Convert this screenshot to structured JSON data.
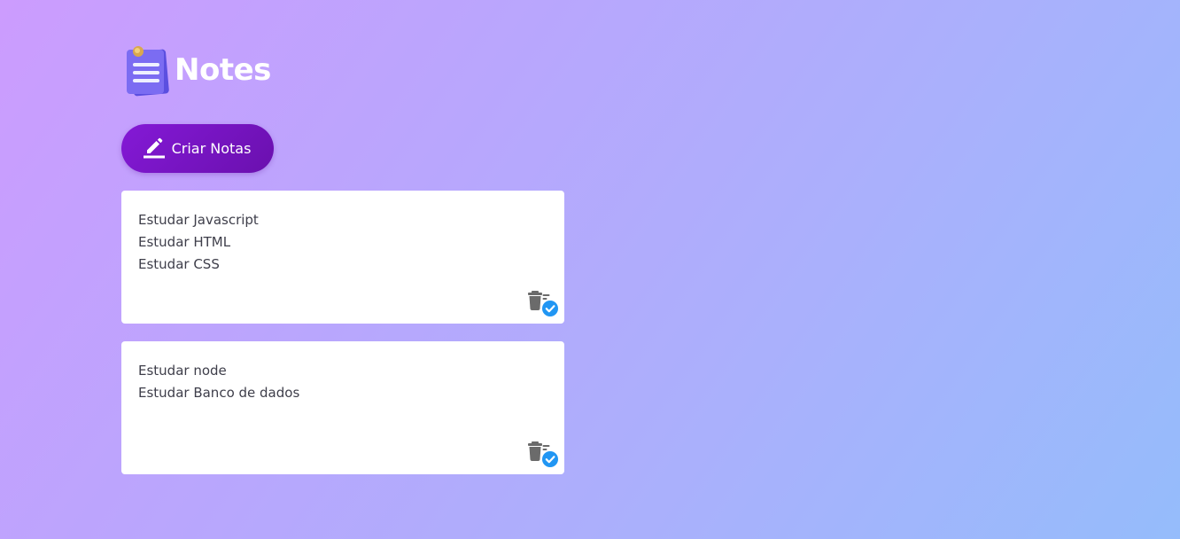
{
  "app": {
    "title": "Notes",
    "logo_icon": "notepad-icon"
  },
  "toolbar": {
    "create_label": "Criar Notas",
    "create_icon": "pencil-icon"
  },
  "notes": [
    {
      "lines": [
        "Estudar Javascript",
        "Estudar HTML",
        "Estudar CSS"
      ]
    },
    {
      "lines": [
        "Estudar node",
        "Estudar Banco de dados"
      ]
    }
  ],
  "note_actions": {
    "delete_icon": "trash-check-icon"
  },
  "colors": {
    "background_start": "#cc9cfe",
    "background_end": "#95bcfb",
    "button": "#7a15c6",
    "note_background": "#ffffff",
    "text": "#3e3e4a",
    "trash": "#6b6b6b",
    "check_badge": "#2196f3"
  }
}
